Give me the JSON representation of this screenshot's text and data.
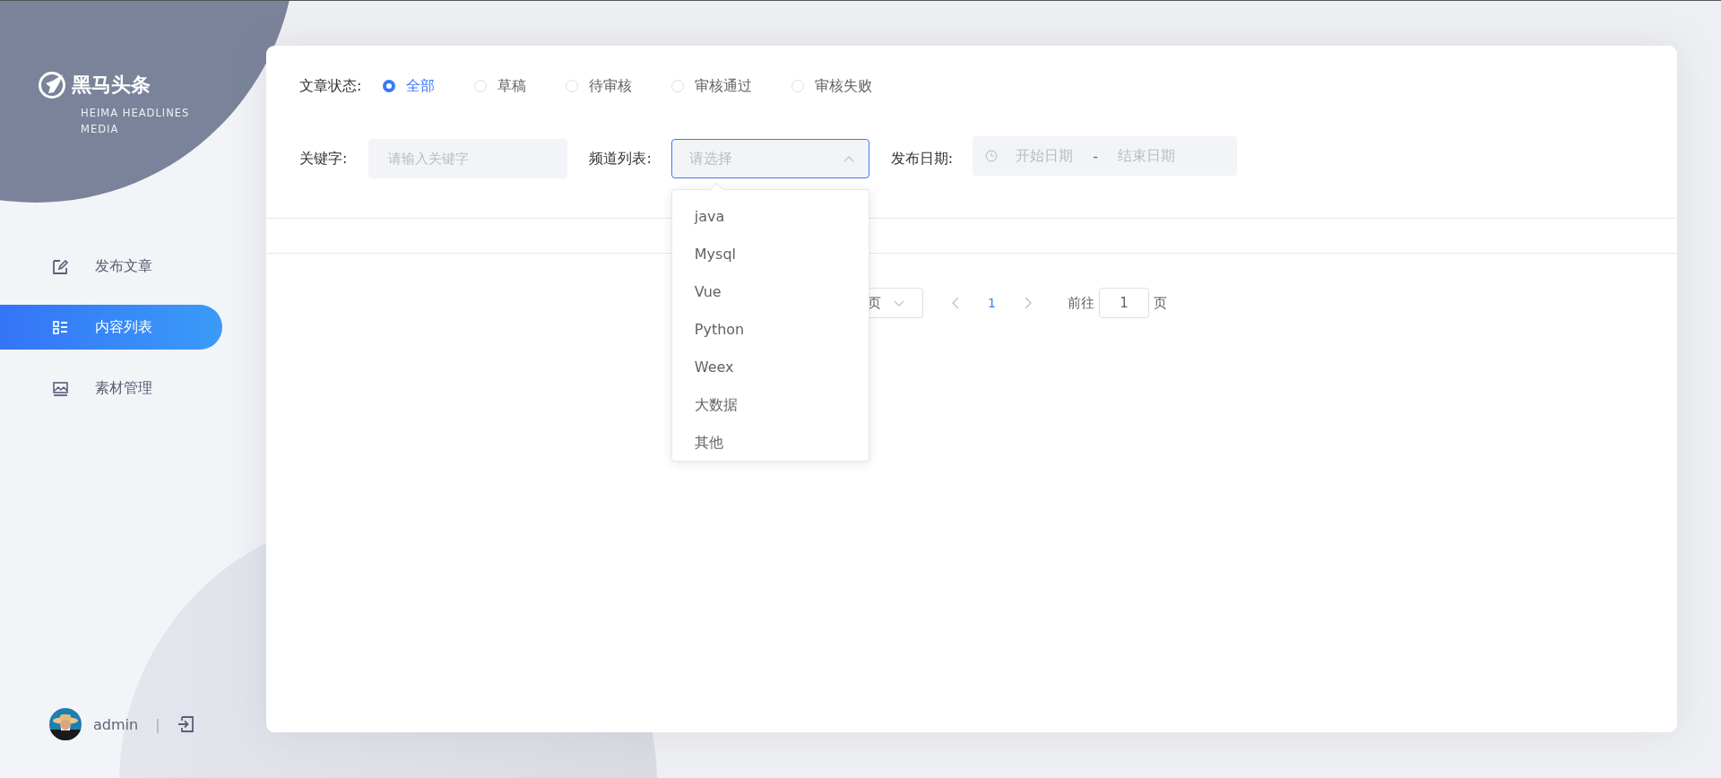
{
  "logo": {
    "title": "黑马头条",
    "subtitle": "HEIMA HEADLINES MEDIA"
  },
  "sidebar": {
    "items": [
      {
        "label": "发布文章",
        "selected": false
      },
      {
        "label": "内容列表",
        "selected": true
      },
      {
        "label": "素材管理",
        "selected": false
      }
    ]
  },
  "user": {
    "name": "admin",
    "separator": "|"
  },
  "filters": {
    "status": {
      "label": "文章状态:",
      "options": [
        {
          "label": "全部",
          "selected": true
        },
        {
          "label": "草稿",
          "selected": false
        },
        {
          "label": "待审核",
          "selected": false
        },
        {
          "label": "审核通过",
          "selected": false
        },
        {
          "label": "审核失败",
          "selected": false
        }
      ]
    },
    "keyword": {
      "label": "关键字:",
      "placeholder": "请输入关键字"
    },
    "channel": {
      "label": "频道列表:",
      "placeholder": "请选择",
      "expanded": true,
      "options": [
        {
          "label": "java"
        },
        {
          "label": "Mysql"
        },
        {
          "label": "Vue"
        },
        {
          "label": "Python"
        },
        {
          "label": "Weex"
        },
        {
          "label": "大数据"
        },
        {
          "label": "其他"
        }
      ]
    },
    "date": {
      "label": "发布日期:",
      "start_placeholder": "开始日期",
      "separator": "-",
      "end_placeholder": "结束日期"
    }
  },
  "pagination": {
    "page_size": "页",
    "pages": [
      {
        "label": "1",
        "selected": true
      }
    ],
    "goto_label": "前往",
    "goto_value": "1",
    "goto_suffix": "页"
  }
}
